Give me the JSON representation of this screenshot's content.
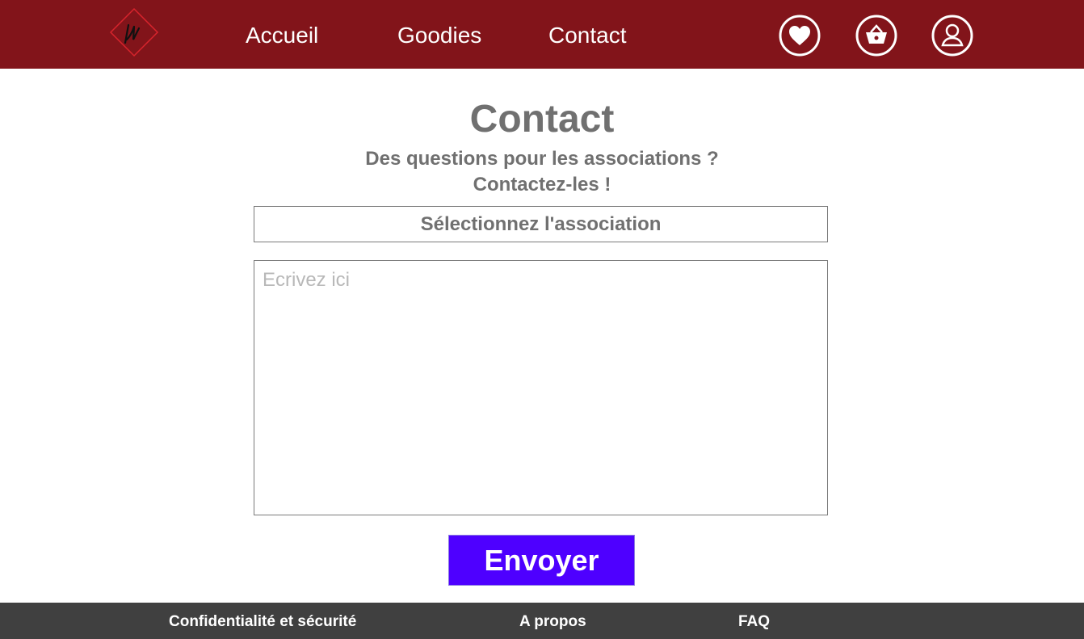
{
  "header": {
    "logo_icon": "diamond-logo-icon",
    "nav": {
      "home": "Accueil",
      "goodies": "Goodies",
      "contact": "Contact"
    },
    "icons": [
      "heart-icon",
      "basket-icon",
      "user-icon"
    ]
  },
  "main": {
    "title": "Contact",
    "subtitle_line1": "Des questions pour les associations ?",
    "subtitle_line2": "Contactez-les !",
    "association_select": "Sélectionnez l'association",
    "message_placeholder": "Ecrivez ici",
    "send_label": "Envoyer"
  },
  "footer": {
    "privacy": "Confidentialité et sécurité",
    "about": "A propos",
    "faq": "FAQ"
  },
  "colors": {
    "header_bg": "#82141a",
    "footer_bg": "#404040",
    "button_bg": "#4e00ff",
    "text_gray": "#707070"
  }
}
